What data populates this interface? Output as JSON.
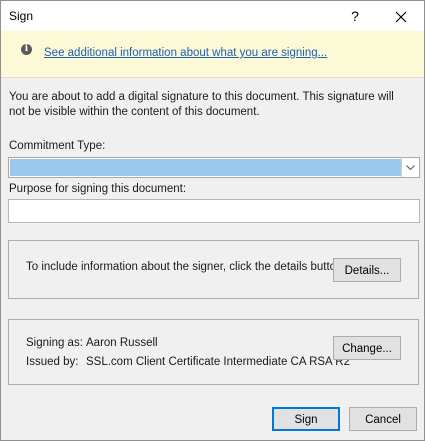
{
  "window": {
    "title": "Sign",
    "help_label": "?",
    "close_label": "✕"
  },
  "infobar": {
    "icon": "info-icon",
    "link_text": "See additional information about what you are signing..."
  },
  "intro_text": "You are about to add a digital signature to this document. This signature will not be visible within the content of this document.",
  "commitment": {
    "label": "Commitment Type:",
    "value": ""
  },
  "purpose": {
    "label": "Purpose for signing this document:",
    "value": ""
  },
  "details_group": {
    "text": "To include information about the signer, click the details button.",
    "button_label": "Details..."
  },
  "signer_group": {
    "signing_as_label": "Signing as:",
    "signing_as_value": "Aaron Russell",
    "issued_by_label": "Issued by:",
    "issued_by_value": "SSL.com Client Certificate Intermediate CA RSA R2",
    "button_label": "Change..."
  },
  "footer": {
    "sign_label": "Sign",
    "cancel_label": "Cancel"
  },
  "colors": {
    "infobar_bg": "#fcf9d6",
    "link": "#1e5fb3",
    "selection": "#99c9ef",
    "default_button_border": "#0078d7"
  }
}
